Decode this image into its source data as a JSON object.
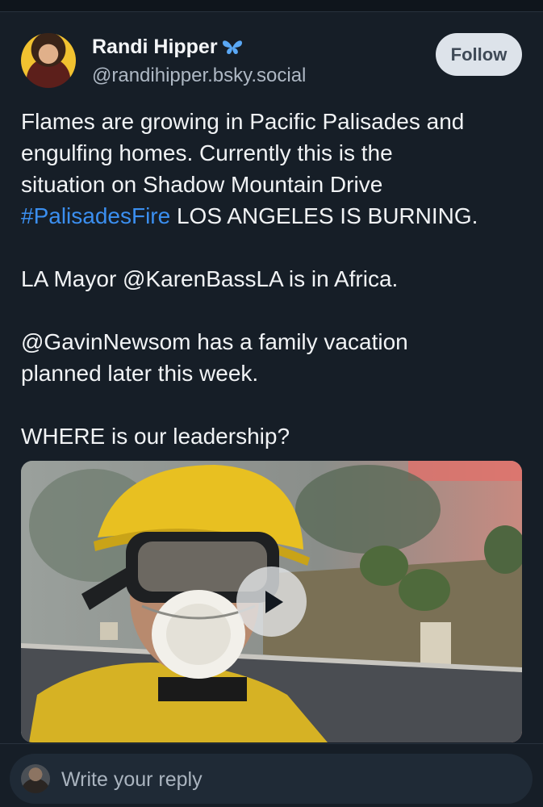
{
  "post": {
    "author": {
      "display_name": "Randi Hipper",
      "handle": "@randihipper.bsky.social",
      "badge_icon": "butterfly-icon"
    },
    "follow_label": "Follow",
    "text": {
      "p1_line1": "Flames are growing in Pacific Palisades and",
      "p1_line2": "engulfing homes.  Currently this is the",
      "p1_line3": "situation on Shadow Mountain Drive",
      "p1_hashtag": "#PalisadesFire",
      "p1_line4_rest": " LOS ANGELES IS BURNING.",
      "p2": "LA Mayor @KarenBassLA is in Africa.",
      "p3_line1": "@GavinNewsom has a family vacation",
      "p3_line2": "planned later this week.",
      "p4": "WHERE is our leadership?"
    },
    "video": {
      "play_icon": "play-icon"
    }
  },
  "reply": {
    "placeholder": "Write your reply"
  },
  "colors": {
    "background": "#161e27",
    "hashtag": "#3b8ff0",
    "follow_bg": "#dde3ea",
    "badge": "#5aa8f5"
  }
}
